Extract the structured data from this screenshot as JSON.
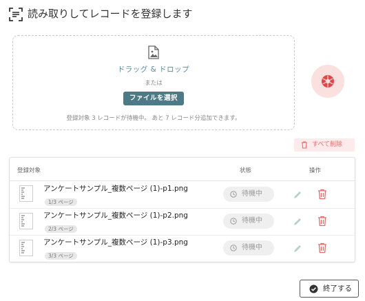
{
  "header": {
    "title": "読み取りしてレコードを登録します",
    "icon": "scan-document-icon"
  },
  "dropzone": {
    "icon": "image-file-icon",
    "title": "ドラッグ & ドロップ",
    "or": "または",
    "select_button": "ファイルを選択",
    "status": "登録対象 3 レコードが待機中。 あと 7 レコード分追加できます。"
  },
  "camera": {
    "icon": "camera-shutter-icon",
    "color": "#e04848",
    "bg": "#fbe0e0"
  },
  "delete_all": {
    "label": "すべて削除",
    "icon": "trash-icon"
  },
  "table": {
    "headers": {
      "target": "登録対象",
      "status": "状態",
      "action": "操作"
    },
    "rows": [
      {
        "filename": "アンケートサンプル_複数ページ (1)-p1.png",
        "page": "1/3 ページ",
        "status": "待機中"
      },
      {
        "filename": "アンケートサンプル_複数ページ (1)-p2.png",
        "page": "2/3 ページ",
        "status": "待機中"
      },
      {
        "filename": "アンケートサンプル_複数ページ (1)-p3.png",
        "page": "3/3 ページ",
        "status": "待機中"
      }
    ]
  },
  "finish": {
    "label": "終了する",
    "icon": "check-circle-icon"
  },
  "colors": {
    "accent": "#4d7a86",
    "danger": "#e56b6b",
    "edit": "#b8d1c0"
  }
}
